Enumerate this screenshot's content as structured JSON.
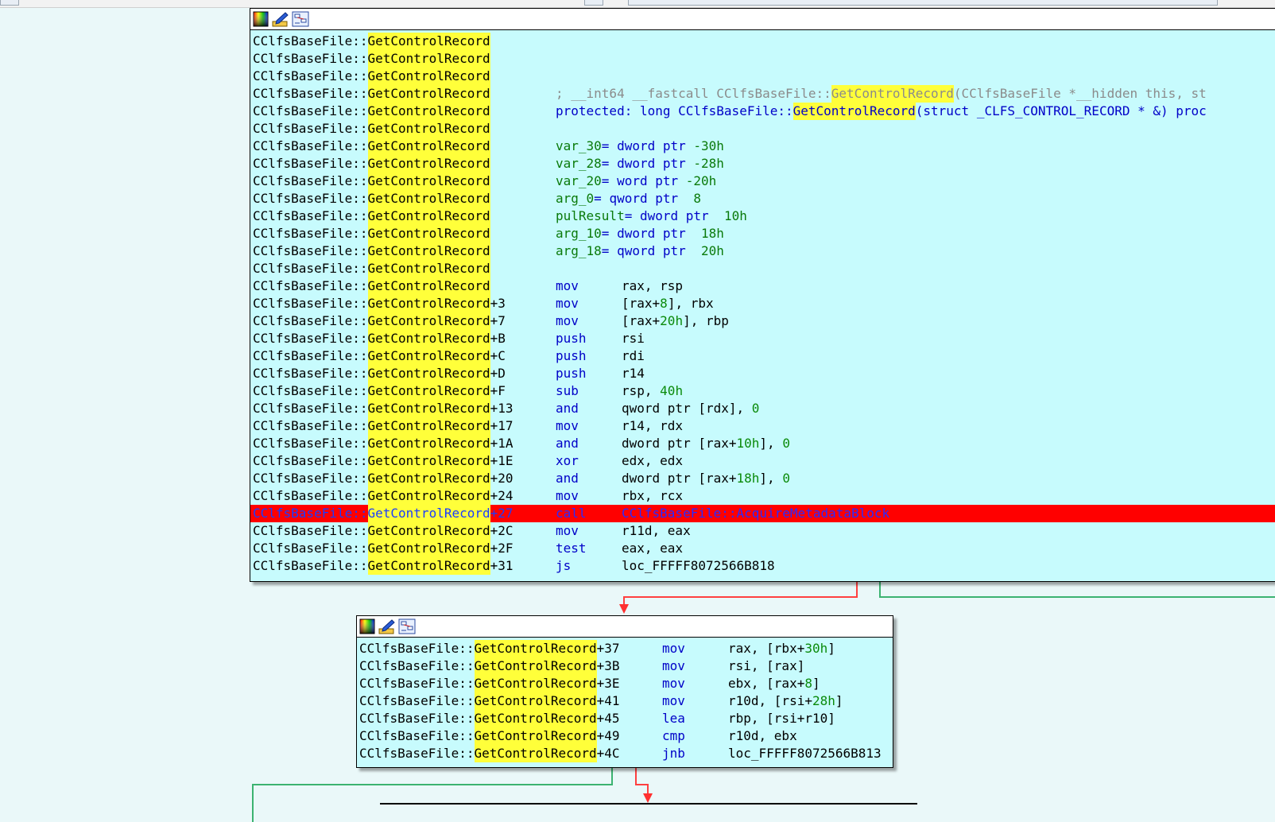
{
  "colors": {
    "background": "#eaf8f9",
    "node_fill": "#c7fbfd",
    "highlight_yellow": "#ffff3a",
    "breakpoint_red": "#ff0000",
    "mnemonic_blue": "#0000c8",
    "number_green": "#0a8a0a",
    "edge_red": "#ff4040",
    "edge_green": "#3cb371"
  },
  "icons": [
    "color-palette-icon",
    "edit-pencil-icon",
    "graph-overview-icon"
  ],
  "block1": {
    "class_prefix": "CClfsBaseFile::",
    "func_name": "GetControlRecord",
    "lines": [
      {
        "offset": "",
        "text": ""
      },
      {
        "offset": "",
        "text": ""
      },
      {
        "offset": "",
        "text": ""
      },
      {
        "offset": "",
        "kind": "comment",
        "pre": "; __int64 __fastcall CClfsBaseFile::",
        "y": "GetControlRecord",
        "post": "(CClfsBaseFile *__hidden this, st"
      },
      {
        "offset": "",
        "kind": "decl",
        "pre": "protected: long CClfsBaseFile::",
        "y": "GetControlRecord",
        "post": "(struct _CLFS_CONTROL_RECORD * &) proc"
      },
      {
        "offset": "",
        "text": ""
      },
      {
        "offset": "",
        "kind": "var",
        "name": "var_30",
        "type": "= dword ptr ",
        "val": "-30h"
      },
      {
        "offset": "",
        "kind": "var",
        "name": "var_28",
        "type": "= dword ptr ",
        "val": "-28h"
      },
      {
        "offset": "",
        "kind": "var",
        "name": "var_20",
        "type": "= word ptr ",
        "val": "-20h"
      },
      {
        "offset": "",
        "kind": "var",
        "name": "arg_0",
        "type": "= qword ptr  ",
        "val": "8"
      },
      {
        "offset": "",
        "kind": "var",
        "name": "pulResult",
        "type": "= dword ptr  ",
        "val": "10h"
      },
      {
        "offset": "",
        "kind": "var",
        "name": "arg_10",
        "type": "= dword ptr  ",
        "val": "18h"
      },
      {
        "offset": "",
        "kind": "var",
        "name": "arg_18",
        "type": "= qword ptr  ",
        "val": "20h"
      },
      {
        "offset": "",
        "text": ""
      },
      {
        "offset": "",
        "kind": "ins",
        "mn": "mov",
        "ops": "rax, rsp"
      },
      {
        "offset": "+3",
        "kind": "ins",
        "mn": "mov",
        "ops": "[rax+8], rbx"
      },
      {
        "offset": "+7",
        "kind": "ins",
        "mn": "mov",
        "ops": "[rax+20h], rbp"
      },
      {
        "offset": "+B",
        "kind": "ins",
        "mn": "push",
        "ops": "rsi"
      },
      {
        "offset": "+C",
        "kind": "ins",
        "mn": "push",
        "ops": "rdi"
      },
      {
        "offset": "+D",
        "kind": "ins",
        "mn": "push",
        "ops": "r14"
      },
      {
        "offset": "+F",
        "kind": "ins",
        "mn": "sub",
        "ops": "rsp, 40h"
      },
      {
        "offset": "+13",
        "kind": "ins",
        "mn": "and",
        "ops": "qword ptr [rdx], 0"
      },
      {
        "offset": "+17",
        "kind": "ins",
        "mn": "mov",
        "ops": "r14, rdx"
      },
      {
        "offset": "+1A",
        "kind": "ins",
        "mn": "and",
        "ops": "dword ptr [rax+10h], 0"
      },
      {
        "offset": "+1E",
        "kind": "ins",
        "mn": "xor",
        "ops": "edx, edx"
      },
      {
        "offset": "+20",
        "kind": "ins",
        "mn": "and",
        "ops": "dword ptr [rax+18h], 0"
      },
      {
        "offset": "+24",
        "kind": "ins",
        "mn": "mov",
        "ops": "rbx, rcx"
      },
      {
        "offset": "+27",
        "kind": "ins",
        "mn": "call",
        "ops": "CClfsBaseFile::AcquireMetadataBlock",
        "highlight": true
      },
      {
        "offset": "+2C",
        "kind": "ins",
        "mn": "mov",
        "ops": "r11d, eax"
      },
      {
        "offset": "+2F",
        "kind": "ins",
        "mn": "test",
        "ops": "eax, eax"
      },
      {
        "offset": "+31",
        "kind": "ins",
        "mn": "js",
        "ops": "loc_FFFFF8072566B818"
      }
    ]
  },
  "block2": {
    "class_prefix": "CClfsBaseFile::",
    "func_name": "GetControlRecord",
    "lines": [
      {
        "offset": "+37",
        "kind": "ins",
        "mn": "mov",
        "ops": "rax, [rbx+30h]"
      },
      {
        "offset": "+3B",
        "kind": "ins",
        "mn": "mov",
        "ops": "rsi, [rax]"
      },
      {
        "offset": "+3E",
        "kind": "ins",
        "mn": "mov",
        "ops": "ebx, [rax+8]"
      },
      {
        "offset": "+41",
        "kind": "ins",
        "mn": "mov",
        "ops": "r10d, [rsi+28h]"
      },
      {
        "offset": "+45",
        "kind": "ins",
        "mn": "lea",
        "ops": "rbp, [rsi+r10]"
      },
      {
        "offset": "+49",
        "kind": "ins",
        "mn": "cmp",
        "ops": "r10d, ebx"
      },
      {
        "offset": "+4C",
        "kind": "ins",
        "mn": "jnb",
        "ops": "loc_FFFFF8072566B813"
      }
    ]
  }
}
